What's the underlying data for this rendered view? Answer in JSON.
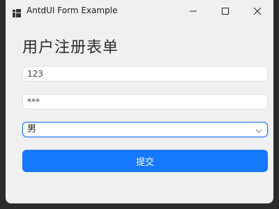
{
  "window": {
    "title": "AntdUI Form Example",
    "icons": {
      "app": "app-icon",
      "minimize": "minimize-icon",
      "maximize": "maximize-icon",
      "close": "close-icon"
    }
  },
  "form": {
    "title": "用户注册表单",
    "username": {
      "value": "123"
    },
    "password": {
      "value": "***"
    },
    "gender": {
      "selected": "男",
      "icon": "chevron-down-icon"
    },
    "submit_label": "提交"
  },
  "colors": {
    "primary": "#1677ff",
    "background": "#f0f0f0",
    "input_bg": "#ffffff"
  }
}
